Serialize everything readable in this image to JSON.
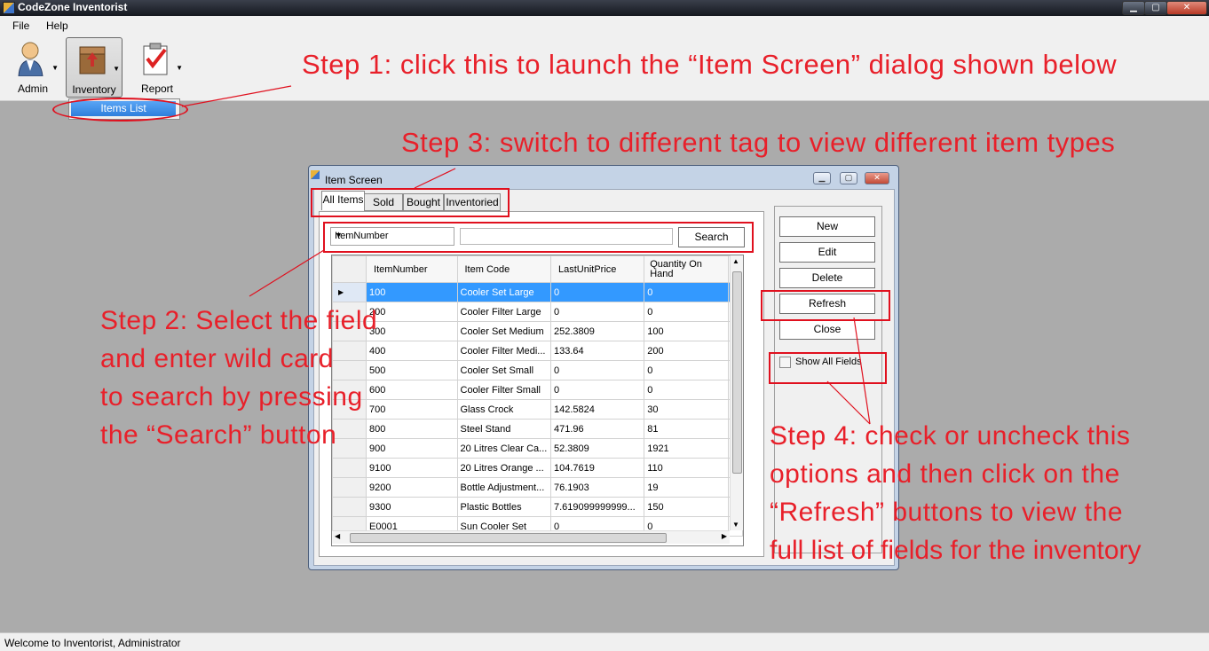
{
  "window": {
    "title": "CodeZone Inventorist"
  },
  "menu": [
    "File",
    "Help"
  ],
  "toolbar": {
    "admin": "Admin",
    "inventory": "Inventory",
    "report": "Report"
  },
  "dropdown_menu": {
    "items_list": "Items List"
  },
  "status": "Welcome to Inventorist, Administrator",
  "dialog": {
    "title": "Item Screen",
    "tabs": [
      "All Items",
      "Sold",
      "Bought",
      "Inventoried"
    ],
    "field_select": "ItemNumber",
    "search_value": "",
    "search_button": "Search",
    "columns": [
      "ItemNumber",
      "Item Code",
      "LastUnitPrice",
      "Quantity On Hand"
    ],
    "rows": [
      [
        "100",
        "Cooler Set Large",
        "0",
        "0"
      ],
      [
        "200",
        "Cooler Filter Large",
        "0",
        "0"
      ],
      [
        "300",
        "Cooler Set Medium",
        "252.3809",
        "100"
      ],
      [
        "400",
        "Cooler Filter Medi...",
        "133.64",
        "200"
      ],
      [
        "500",
        "Cooler Set Small",
        "0",
        "0"
      ],
      [
        "600",
        "Cooler Filter Small",
        "0",
        "0"
      ],
      [
        "700",
        "Glass Crock",
        "142.5824",
        "30"
      ],
      [
        "800",
        "Steel Stand",
        "471.96",
        "81"
      ],
      [
        "900",
        "20 Litres Clear Ca...",
        "52.3809",
        "1921"
      ],
      [
        "9100",
        "20 Litres Orange ...",
        "104.7619",
        "110"
      ],
      [
        "9200",
        "Bottle Adjustment...",
        "76.1903",
        "19"
      ],
      [
        "9300",
        "Plastic Bottles",
        "7.619099999999...",
        "150"
      ],
      [
        "E0001",
        "Sun Cooler Set",
        "0",
        "0"
      ]
    ],
    "buttons": {
      "new": "New",
      "edit": "Edit",
      "delete": "Delete",
      "refresh": "Refresh",
      "close": "Close"
    },
    "show_all_fields": {
      "label": "Show All Fields",
      "checked": false
    }
  },
  "annotations": {
    "step1": "Step 1: click this to launch the “Item Screen” dialog shown below",
    "step3": "Step 3: switch to different tag to view different item types",
    "step2": [
      "Step 2: Select the field",
      "and enter wild card",
      "to search by pressing",
      "the “Search” button"
    ],
    "step4": [
      "Step 4: check or uncheck this",
      "options and then click on the",
      "“Refresh” buttons to view the",
      "full list of fields for the inventory"
    ]
  },
  "colors": {
    "annotation": "#e8202a",
    "selection": "#3399ff",
    "desktop": "#ababab"
  }
}
